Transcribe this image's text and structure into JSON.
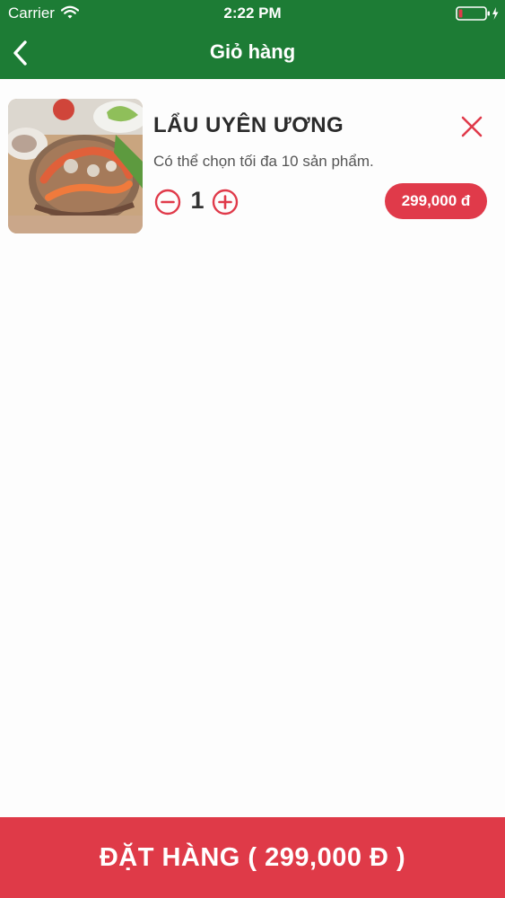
{
  "status_bar": {
    "carrier": "Carrier",
    "time": "2:22 PM"
  },
  "nav": {
    "title": "Giỏ hàng"
  },
  "cart": {
    "items": [
      {
        "name": "LẨU UYÊN ƯƠNG",
        "note": "Có thể chọn tối đa 10 sản phẩm.",
        "quantity": "1",
        "price": "299,000 đ"
      }
    ]
  },
  "order_button": {
    "label": "ĐẶT HÀNG ( 299,000 Đ )"
  },
  "colors": {
    "header_green": "#1d7c35",
    "accent_red": "#e03a4a"
  }
}
